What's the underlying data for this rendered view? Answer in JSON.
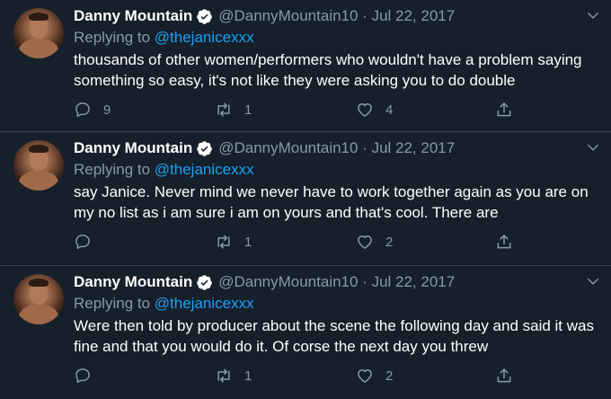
{
  "tweets": [
    {
      "author_name": "Danny Mountain",
      "handle_meta": "@DannyMountain10 · Jul 22, 2017",
      "replying_prefix": "Replying to",
      "replying_to": "@thejanicexxx",
      "text": "thousands of other women/performers who wouldn't have a problem saying something so easy, it's not like they were asking you to do double",
      "reply_count": "9",
      "retweet_count": "1",
      "like_count": "4"
    },
    {
      "author_name": "Danny Mountain",
      "handle_meta": "@DannyMountain10 · Jul 22, 2017",
      "replying_prefix": "Replying to",
      "replying_to": "@thejanicexxx",
      "text": "say Janice. Never mind we never have to work together again as you are on my no list as i am sure i am on yours and that's cool. There are",
      "reply_count": "",
      "retweet_count": "1",
      "like_count": "2"
    },
    {
      "author_name": "Danny Mountain",
      "handle_meta": "@DannyMountain10 · Jul 22, 2017",
      "replying_prefix": "Replying to",
      "replying_to": "@thejanicexxx",
      "text": "Were then told by producer about the scene the following day and said it was fine and that you would do it. Of corse the next day you threw",
      "reply_count": "",
      "retweet_count": "1",
      "like_count": "2"
    }
  ],
  "icons": {
    "verified": "verified-badge-icon",
    "more": "chevron-down-icon",
    "reply": "reply-bubble-icon",
    "retweet": "retweet-icon",
    "like": "heart-icon",
    "share": "share-upload-icon"
  },
  "colors": {
    "background": "#15202b",
    "divider": "#38444d",
    "primary_text": "#ffffff",
    "secondary_text": "#8899a6",
    "link": "#1da1f2"
  }
}
